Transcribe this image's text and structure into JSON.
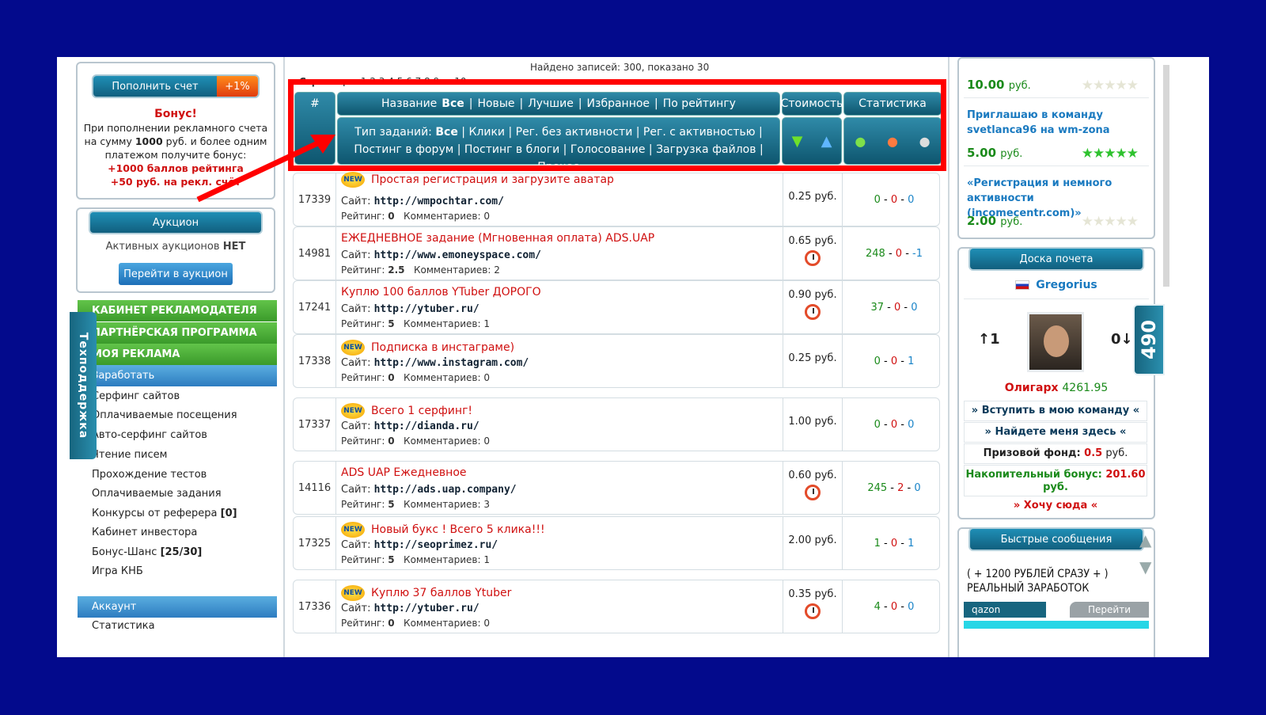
{
  "left": {
    "topup_label": "Пополнить счет",
    "topup_badge": "+1%",
    "bonus_title": "Бонус!",
    "bonus_l1": "При пополнении рекламного счета",
    "bonus_l2a": "на сумму ",
    "bonus_l2b": "1000",
    "bonus_l2c": " руб. и более одним",
    "bonus_l3": "платежом получите бонус:",
    "bonus_l4": "+1000 баллов рейтинга",
    "bonus_l5": "+50 руб. на рекл. счёт",
    "auction_title": "Аукцион",
    "auction_text": "Активных аукционов ",
    "auction_none": "НЕТ",
    "auction_button": "Перейти в аукцион",
    "menu": [
      "КАБИНЕТ РЕКЛАМОДАТЕЛЯ",
      "ПАРТНЁРСКАЯ ПРОГРАММА",
      "МОЯ РЕКЛАМА"
    ],
    "earn": "Заработать",
    "submenu": [
      "Серфинг сайтов",
      "Оплачиваемые посещения",
      "Авто-серфинг сайтов",
      "Чтение писем",
      "Прохождение тестов",
      "Оплачиваемые задания"
    ],
    "sub_ref": "Конкурсы от реферера ",
    "sub_ref_count": "[0]",
    "sub_investor": "Кабинет инвестора",
    "sub_bonus": "Бонус-Шанс ",
    "sub_bonus_count": "[25/30]",
    "sub_game": "Игра КНБ",
    "account": "Аккаунт",
    "stats": "Статистика",
    "support_tab": "Техподдержка"
  },
  "main": {
    "found": "Найдено записей: 300, показано 30",
    "pages_label": "Страницы:",
    "pages": "1 2 3 4 5 6 7 8 9 ... 10",
    "col_num": "#",
    "name_label": "Название",
    "filters": [
      "Все",
      "Новые",
      "Лучшие",
      "Избранное",
      "По рейтингу"
    ],
    "col_cost": "Стоимость",
    "col_stats": "Статистика",
    "type_label": "Тип заданий:",
    "types": [
      "Все",
      "Клики",
      "Рег. без активности",
      "Рег. с активностью",
      "Постинг в форум",
      "Постинг в блоги",
      "Голосование",
      "Загрузка файлов",
      "Прочее"
    ],
    "rows": [
      {
        "id": "17339",
        "new": true,
        "title": "Простая регистрация и загрузите аватар",
        "site": "http://wmpochtar.com/",
        "rating": "0",
        "comments": "0",
        "cost": "0.25 руб.",
        "clock": false,
        "s1": "0",
        "s2": "0",
        "s3": "0"
      },
      {
        "id": "14981",
        "new": false,
        "title": "ЕЖЕДНЕВНОЕ задание (Мгновенная оплата) ADS.UAP",
        "site": "http://www.emoneyspace.com/",
        "rating": "2.5",
        "comments": "2",
        "cost": "0.65 руб.",
        "clock": true,
        "s1": "248",
        "s2": "0",
        "s3": "-1"
      },
      {
        "id": "17241",
        "new": false,
        "title": "Куплю 100 баллов YTuber ДОРОГО",
        "site": "http://ytuber.ru/",
        "rating": "5",
        "comments": "1",
        "cost": "0.90 руб.",
        "clock": true,
        "s1": "37",
        "s2": "0",
        "s3": "0"
      },
      {
        "id": "17338",
        "new": true,
        "title": "Подписка в инстаграме)",
        "site": "http://www.instagram.com/",
        "rating": "0",
        "comments": "0",
        "cost": "0.25 руб.",
        "clock": false,
        "s1": "0",
        "s2": "0",
        "s3": "1"
      },
      {
        "id": "17337",
        "new": true,
        "title": "Всего 1 серфинг!",
        "site": "http://dianda.ru/",
        "rating": "0",
        "comments": "0",
        "cost": "1.00 руб.",
        "clock": false,
        "s1": "0",
        "s2": "0",
        "s3": "0"
      },
      {
        "id": "14116",
        "new": false,
        "title": "ADS UAP Ежедневное",
        "site": "http://ads.uap.company/",
        "rating": "5",
        "comments": "3",
        "cost": "0.60 руб.",
        "clock": true,
        "s1": "245",
        "s2": "2",
        "s3": "0"
      },
      {
        "id": "17325",
        "new": true,
        "title": "Новый букс ! Всего 5 клика!!!",
        "site": "http://seoprimez.ru/",
        "rating": "5",
        "comments": "1",
        "cost": "2.00 руб.",
        "clock": false,
        "s1": "1",
        "s2": "0",
        "s3": "1"
      },
      {
        "id": "17336",
        "new": true,
        "title": "Куплю 37 баллов Ytuber",
        "site": "http://ytuber.ru/",
        "rating": "0",
        "comments": "0",
        "cost": "0.35 руб.",
        "clock": true,
        "s1": "4",
        "s2": "0",
        "s3": "0"
      }
    ],
    "site_label": "Сайт:",
    "rating_label": "Рейтинг:",
    "comments_label": "Комментариев:"
  },
  "right": {
    "ad1_price": "10.00",
    "rub": "руб.",
    "ad2_text": "Приглашаю в команду svetlanca96 на wm-zona",
    "ad2_price": "5.00",
    "ad3_text": "«Регистрация и немного активности (incomecentr.com)»",
    "ad3_price": "2.00",
    "honor_title": "Доска почета",
    "honor_user": "Gregorius",
    "up": "↑1",
    "down": "0↓",
    "oligarch_label": "Олигарх",
    "oligarch_value": "4261.95",
    "join_team": "» Вступить в мою команду «",
    "find_me": "» Найдете меня здесь «",
    "prize_label": "Призовой фонд: ",
    "prize_value": "0.5",
    "prize_unit": " руб.",
    "accum_label": "Накопительный бонус: ",
    "accum_value": "201.60",
    "accum_unit": "руб.",
    "want_here": "» Хочу сюда «",
    "quick_title": "Быстрые сообщения",
    "quick_msg": "( + 1200 РУБЛЕЙ СРАЗУ + ) РЕАЛЬНЫЙ ЗАРАБОТОК",
    "quick_user": "qazon",
    "quick_go": "Перейти",
    "counter": "490"
  },
  "colors": {
    "frame": "#030a8c",
    "highlight": "#ff0000",
    "header": "#0e566f",
    "green": "#1a8a1a",
    "red": "#d01010"
  }
}
